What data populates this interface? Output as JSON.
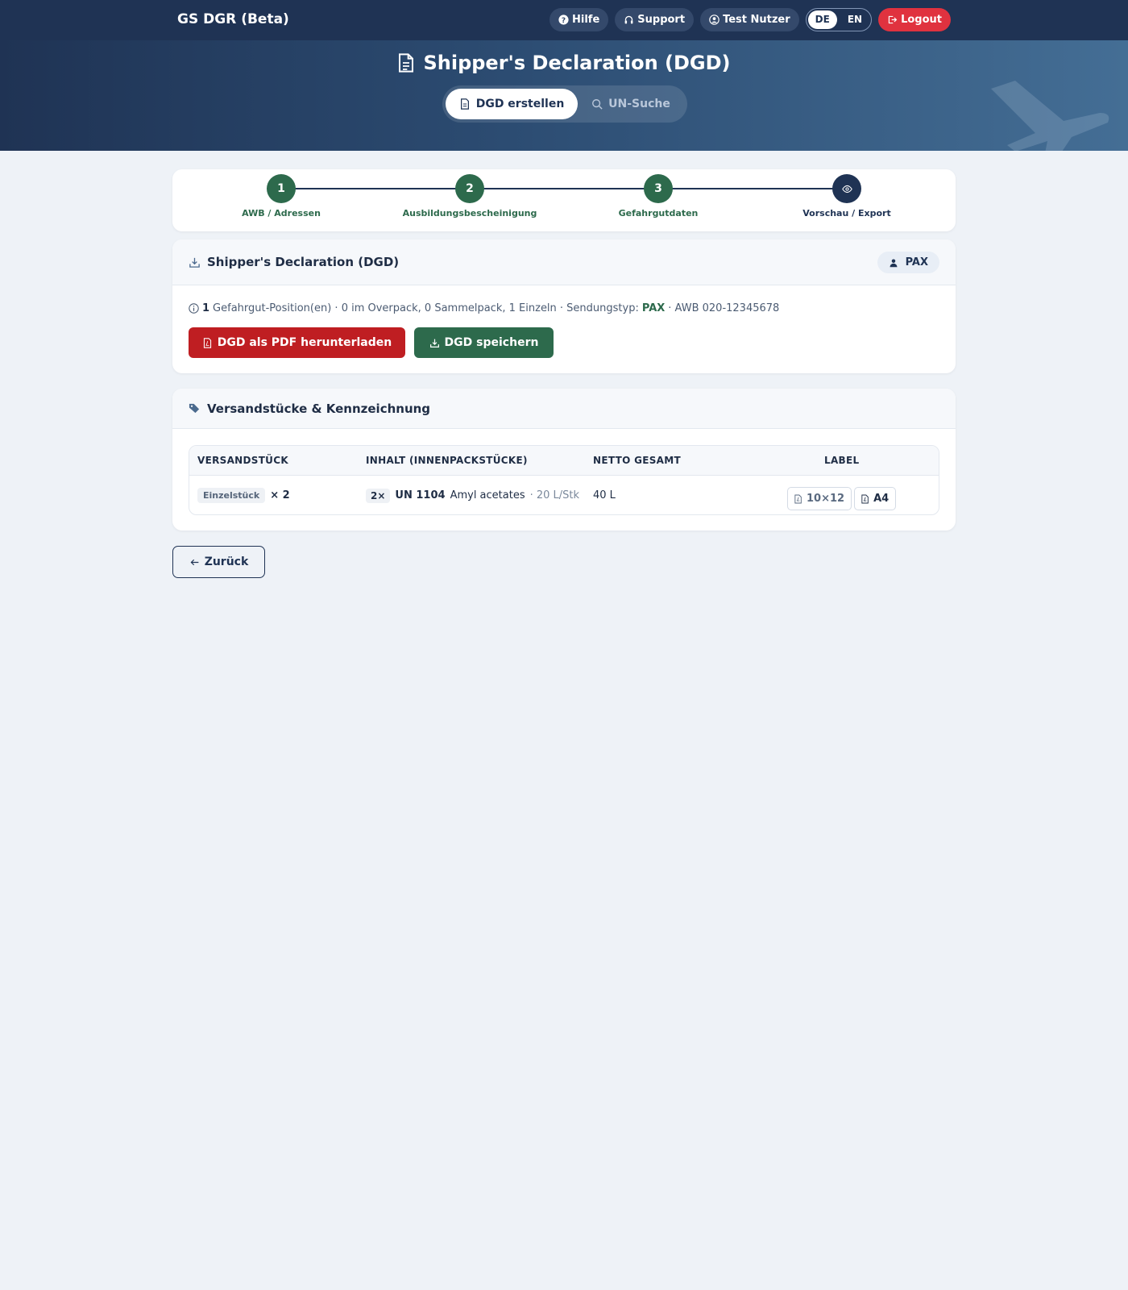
{
  "navbar": {
    "brand": "GS DGR (Beta)",
    "help_label": "Hilfe",
    "support_label": "Support",
    "user_label": "Test Nutzer",
    "lang_de": "DE",
    "lang_en": "EN",
    "active_lang": "DE",
    "logout_label": "Logout"
  },
  "hero": {
    "title": "Shipper's Declaration (DGD)",
    "tabs": [
      {
        "label": "DGD erstellen",
        "active": true
      },
      {
        "label": "UN-Suche",
        "active": false
      }
    ]
  },
  "stepper": {
    "steps": [
      {
        "number": "1",
        "label": "AWB / Adressen",
        "state": "done"
      },
      {
        "number": "2",
        "label": "Ausbildungsbescheinigung",
        "state": "done"
      },
      {
        "number": "3",
        "label": "Gefahrgutdaten",
        "state": "done"
      },
      {
        "number": "",
        "label": "Vorschau / Export",
        "state": "current",
        "icon": "eye-icon"
      }
    ]
  },
  "dgd_card": {
    "title": "Shipper's Declaration (DGD)",
    "badge": "PAX",
    "info": {
      "count": "1",
      "text": "Gefahrgut-Position(en) · 0 im Overpack, 0 Sammelpack, 1 Einzeln · Sendungstyp:",
      "type": "PAX",
      "awb": "· AWB 020-12345678"
    },
    "pdf_button": "DGD als PDF herunterladen",
    "save_button": "DGD speichern"
  },
  "packages_card": {
    "title": "Versandstücke & Kennzeichnung",
    "columns": [
      "VERSANDSTÜCK",
      "INHALT (INNENPACKSTÜCKE)",
      "NETTO GESAMT",
      "LABEL"
    ],
    "rows": [
      {
        "package_type": "Einzelstück",
        "count": "× 2",
        "inner_qty": "2×",
        "un_number": "UN 1104",
        "substance": "Amyl acetates",
        "per_unit": "· 20 L/Stk",
        "net_total": "40 L",
        "labels": [
          "10×12",
          "A4"
        ]
      }
    ]
  },
  "back_button": "Zurück",
  "colors": {
    "navy": "#1f3354",
    "green": "#2d6a4c",
    "red": "#bf1e22",
    "logout_red": "#e0323f",
    "background": "#eef2f7"
  }
}
